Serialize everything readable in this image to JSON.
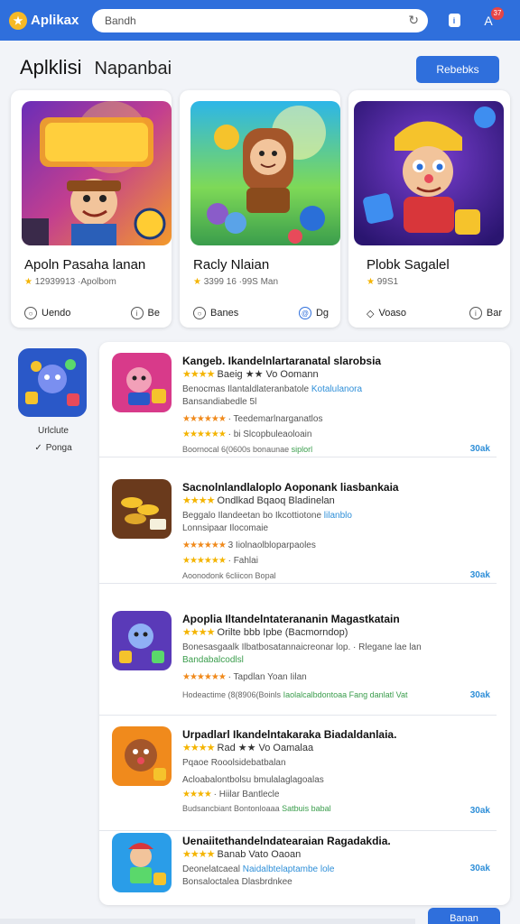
{
  "topbar": {
    "logo_text": "Aplikax",
    "search_placeholder": "Bandh",
    "badge_count": "37"
  },
  "header": {
    "title": "Aplklisi",
    "subtitle": "Napanbai",
    "button": "Rebebks"
  },
  "featured": [
    {
      "title": "Apoln Pasaha lanan",
      "meta": "12939913 ·Apolbom",
      "btn_a": "Uendo",
      "btn_b": "Be"
    },
    {
      "title": "Racly Nlaian",
      "meta": "3399 16 ·99S Man",
      "btn_a": "Banes",
      "btn_b": "Dg"
    },
    {
      "title": "Plobk Sagalel",
      "meta": "99S1",
      "btn_a": "Voaso",
      "btn_b": "Bar"
    }
  ],
  "side_app": {
    "label": "Urlclute",
    "sub": "Ponga"
  },
  "list": [
    {
      "t1": "Kangeb. Ikandelnlartaranatal slarobsia",
      "t2": "Baeig ★★ Vo Oomann",
      "t3a": "Benocmas Ilantaldlateranbatole ",
      "t3b": "Kotalulanora",
      "t4": "Bansandiabedle 5l",
      "t5": "Teedemarlnarganatlos",
      "t6": "bi Slcopbuleaoloain",
      "t7a": "Boornocal 6(0600s bonaunae ",
      "t7b": "siplorl",
      "size": "30ak"
    },
    {
      "t1": "Sacnolnlandlaloplo Aoponank liasbankaia",
      "t2": "Ondlkad Bqaoq Bladinelan",
      "t3a": "Beggalo Ilandeetan bo Ikcottiotone ",
      "t3b": "lilanblo",
      "t4": "Lonnsipaar Ilocomaie",
      "t5": "3 Iiolnaolbloparpaoles",
      "t6": "Fahlai",
      "t7a": "Aoonodonk 6cliicon Bopal",
      "t7b": "",
      "size": "30ak"
    },
    {
      "t1": "Apoplia Iltandelntaterananin Magastkatain",
      "t2": "Orilte bbb Ipbe (Bacmorndop)",
      "t3a": "Bonesasgaalk Ilbatbosatannaicreonar lop. ",
      "t3b": "· Rlegane lae lan",
      "t4": "Bandabalcodlsl",
      "t5": "Tapdlan Yoan Iilan",
      "t6": "",
      "t7a": "Hodeactime (8(8906(Boinls ",
      "t7b": "Iaolalcalbdontoaa Fang danlatl Vat",
      "size": "30ak"
    },
    {
      "t1": "Urpadlarl Ikandelntakaraka Biadaldanlaia.",
      "t2": "Rad ★★ Vo Oamalaa",
      "t3a": "Pqaoe Rooolsidebatbalan",
      "t3b": "",
      "t4": "",
      "t5": "Acloabalontbolsu bmulalaglagoalas",
      "t6": "Hiilar Bantlecle",
      "t7a": "Budsancbiant Bontonloaaa ",
      "t7b": "Satbuis babal",
      "size": "30ak"
    },
    {
      "t1": "Uenaiitethandelndatearaian Ragadakdia.",
      "t2": "Banab Vato Oaoan",
      "t3a": "Deonelatcaeal ",
      "t3b": "Naidalbtelaptambe lole",
      "t4": "Bonsaloctalea Dlasbrdnkee",
      "t5": "",
      "t6": "",
      "t7a": "",
      "t7b": "",
      "size": "30ak"
    }
  ],
  "fab_label": "Banan",
  "colors": {
    "primary": "#2f6fdc",
    "star": "#f4b400",
    "link": "#2f8fd8"
  }
}
